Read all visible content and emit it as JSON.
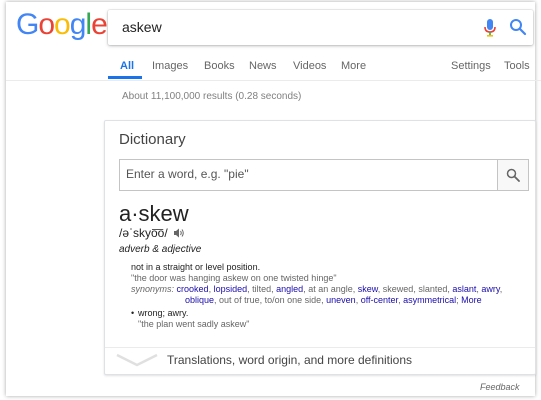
{
  "header": {
    "logo": [
      "G",
      "o",
      "o",
      "g",
      "l",
      "e"
    ],
    "query": "askew"
  },
  "tabs": {
    "items": [
      "All",
      "Images",
      "Books",
      "News",
      "Videos",
      "More"
    ],
    "settings": "Settings",
    "tools": "Tools",
    "active": "All"
  },
  "results_stats": "About 11,100,000 results (0.28 seconds)",
  "dictionary": {
    "title": "Dictionary",
    "input_placeholder": "Enter a word, e.g. \"pie\"",
    "headword": "a·skew",
    "pronunciation": "/əˈskyo͞o/",
    "part_of_speech": "adverb & adjective",
    "sense1": {
      "definition": "not in a straight or level position.",
      "example": "\"the door was hanging askew on one twisted hinge\"",
      "synonyms_label": "synonyms:",
      "synonyms": [
        {
          "text": "crooked",
          "link": true
        },
        {
          "text": "lopsided",
          "link": true
        },
        {
          "text": "tilted",
          "link": false
        },
        {
          "text": "angled",
          "link": true
        },
        {
          "text": "at an angle",
          "link": false
        },
        {
          "text": "skew",
          "link": true
        },
        {
          "text": "skewed",
          "link": false
        },
        {
          "text": "slanted",
          "link": false
        },
        {
          "text": "aslant",
          "link": true
        },
        {
          "text": "awry",
          "link": true
        }
      ],
      "synonyms_line2": [
        {
          "text": "oblique",
          "link": true
        },
        {
          "text": "out of true",
          "link": false
        },
        {
          "text": "to/on one side",
          "link": false
        },
        {
          "text": "uneven",
          "link": true
        },
        {
          "text": "off-center",
          "link": true
        },
        {
          "text": "asymmetrical",
          "link": true
        }
      ],
      "more": "More"
    },
    "sense2": {
      "definition": "wrong; awry.",
      "example": "\"the plan went sadly askew\""
    },
    "footer": "Translations, word origin, and more definitions"
  },
  "feedback": "Feedback",
  "colors": {
    "blue": "#4285F4",
    "red": "#EA4335",
    "yellow": "#FBBC05",
    "green": "#34A853",
    "link": "#1a0dab",
    "tab_active": "#1a73e8"
  },
  "icons": [
    "mic-icon",
    "search-icon",
    "speaker-icon",
    "chevron-down-icon"
  ]
}
